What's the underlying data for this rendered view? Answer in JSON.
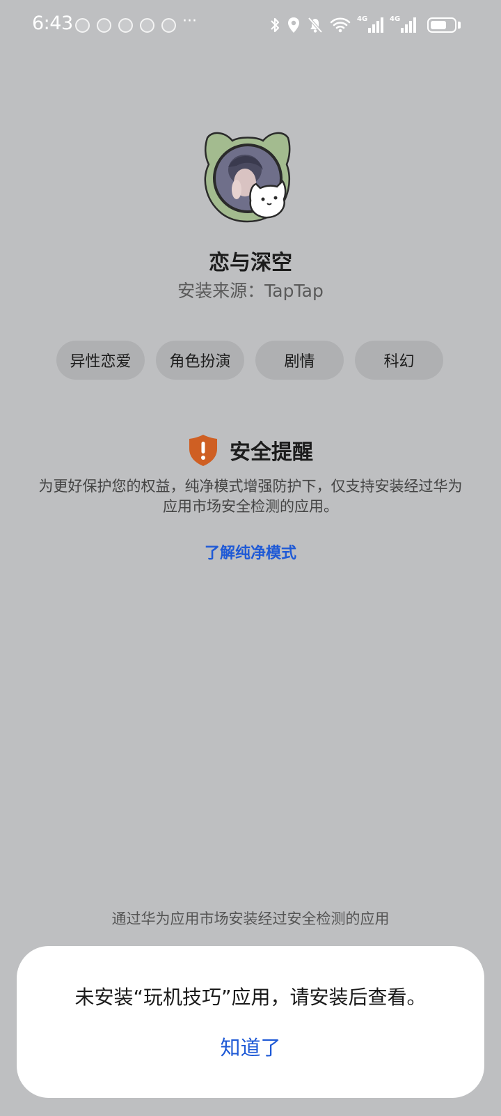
{
  "status_bar": {
    "time": "6:43",
    "notification_icon_count": 5,
    "more": "···",
    "network_1": "4G",
    "network_2": "4G",
    "battery_level": 0.7
  },
  "app": {
    "name": "恋与深空",
    "source": "安装来源：TapTap",
    "tags": [
      "异性恋爱",
      "角色扮演",
      "剧情",
      "科幻"
    ]
  },
  "security": {
    "title": "安全提醒",
    "description": "为更好保护您的权益，纯净模式增强防护下，仅支持安装经过华为应用市场安全检测的应用。",
    "learn_more": "了解纯净模式"
  },
  "bottom_hint": "通过华为应用市场安装经过安全检测的应用",
  "dialog": {
    "message": "未安装“玩机技巧”应用，请安装后查看。",
    "button": "知道了"
  },
  "colors": {
    "background": "#bebfc1",
    "accent": "#1f5ad6",
    "shield": "#cf5f23"
  }
}
